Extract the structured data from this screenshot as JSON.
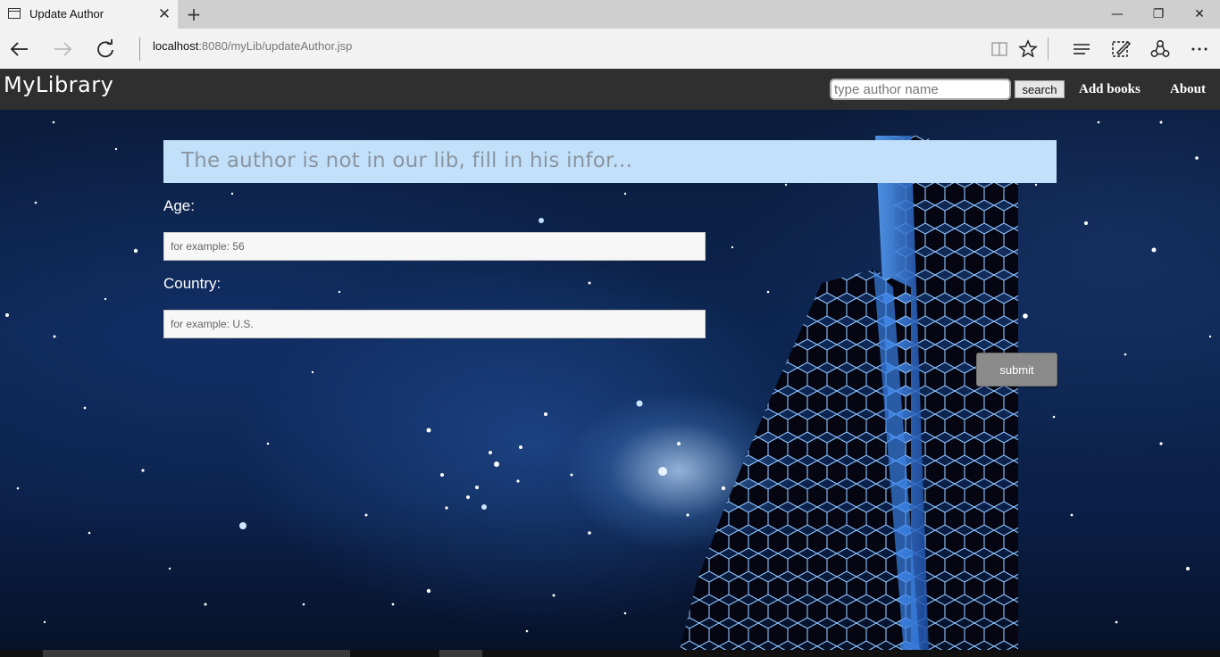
{
  "browser": {
    "tab_title": "Update Author",
    "tab_close": "✕",
    "new_tab": "+",
    "url_host": "localhost",
    "url_rest": ":8080/myLib/updateAuthor.jsp",
    "window_controls": {
      "minimize": "—",
      "restore": "❐",
      "close": "✕"
    }
  },
  "site": {
    "logo": "MyLibrary",
    "search": {
      "placeholder": "type author name",
      "value": "",
      "button": "search"
    },
    "nav": [
      "Add books",
      "About"
    ]
  },
  "form": {
    "banner": "The author is not in our lib, fill in his infor...",
    "age_label": "Age:",
    "age_placeholder": "for example: 56",
    "country_label": "Country:",
    "country_placeholder": "for example: U.S.",
    "submit": "submit"
  },
  "colors": {
    "header_bg": "#2f2f2f",
    "banner_bg": "#c3e0fb",
    "submit_bg": "#8a8a8a"
  },
  "icons": {
    "back": "back-arrow-icon",
    "forward": "forward-arrow-icon",
    "refresh": "refresh-icon",
    "reading_view": "reading-view-icon",
    "favorite": "star-icon",
    "hub": "hub-icon",
    "notes": "web-note-icon",
    "share": "share-icon",
    "more": "more-icon"
  }
}
